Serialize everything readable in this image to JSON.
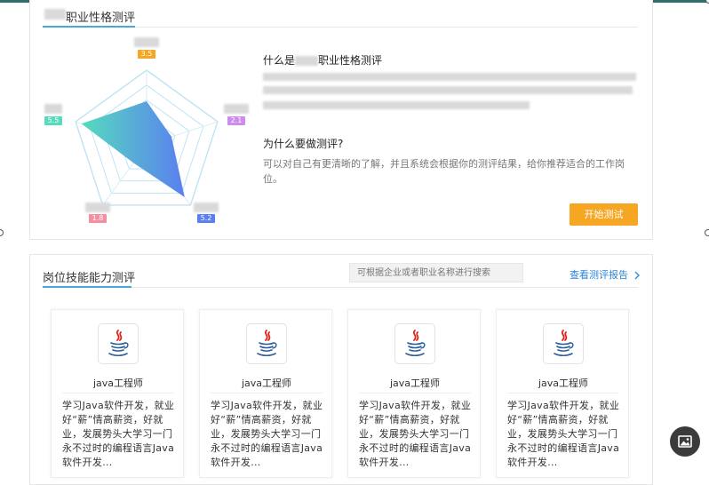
{
  "colors": {
    "accent": "#4aa8d8",
    "button": "#f5a623",
    "link": "#2a84d8",
    "radar_fill_start": "#55dbbd",
    "radar_fill_end": "#5b7ff0",
    "badge_top": "#f5a623",
    "badge_right": "#cf8cf0",
    "badge_bottom_right": "#5b7ff0",
    "badge_bottom_left": "#f28fa0",
    "badge_left": "#55dbbd"
  },
  "personality": {
    "title": "职业性格测评",
    "radar": {
      "scores": [
        "3.5",
        "2.1",
        "5.2",
        "1.8",
        "5.5"
      ],
      "values": [
        3.5,
        2.1,
        5.2,
        1.8,
        5.5
      ],
      "max": 6
    },
    "what_title": "什么是职业性格测评",
    "why_title": "为什么要做测评?",
    "why_text": "可以对自己有更清晰的了解，并且系统会根据你的测评结果，给你推荐适合的工作岗位。",
    "start_button": "开始测试"
  },
  "skills": {
    "title": "岗位技能能力测评",
    "search_placeholder": "可根据企业或者职业名称进行搜索",
    "report_link": "查看测评报告",
    "report_icon": "chevron-right-icon",
    "cards": [
      {
        "icon": "java-logo-icon",
        "name": "java工程师",
        "desc": "学习Java软件开发，就业好“薪”情高薪资，好就业，发展势头大学习一门永不过时的编程语言Java软件开发..."
      },
      {
        "icon": "java-logo-icon",
        "name": "java工程师",
        "desc": "学习Java软件开发，就业好“薪”情高薪资，好就业，发展势头大学习一门永不过时的编程语言Java软件开发..."
      },
      {
        "icon": "java-logo-icon",
        "name": "java工程师",
        "desc": "学习Java软件开发，就业好“薪”情高薪资，好就业，发展势头大学习一门永不过时的编程语言Java软件开发..."
      },
      {
        "icon": "java-logo-icon",
        "name": "java工程师",
        "desc": "学习Java软件开发，就业好“薪”情高薪资，好就业，发展势头大学习一门永不过时的编程语言Java软件开发..."
      }
    ]
  },
  "fab_icon": "image-icon"
}
